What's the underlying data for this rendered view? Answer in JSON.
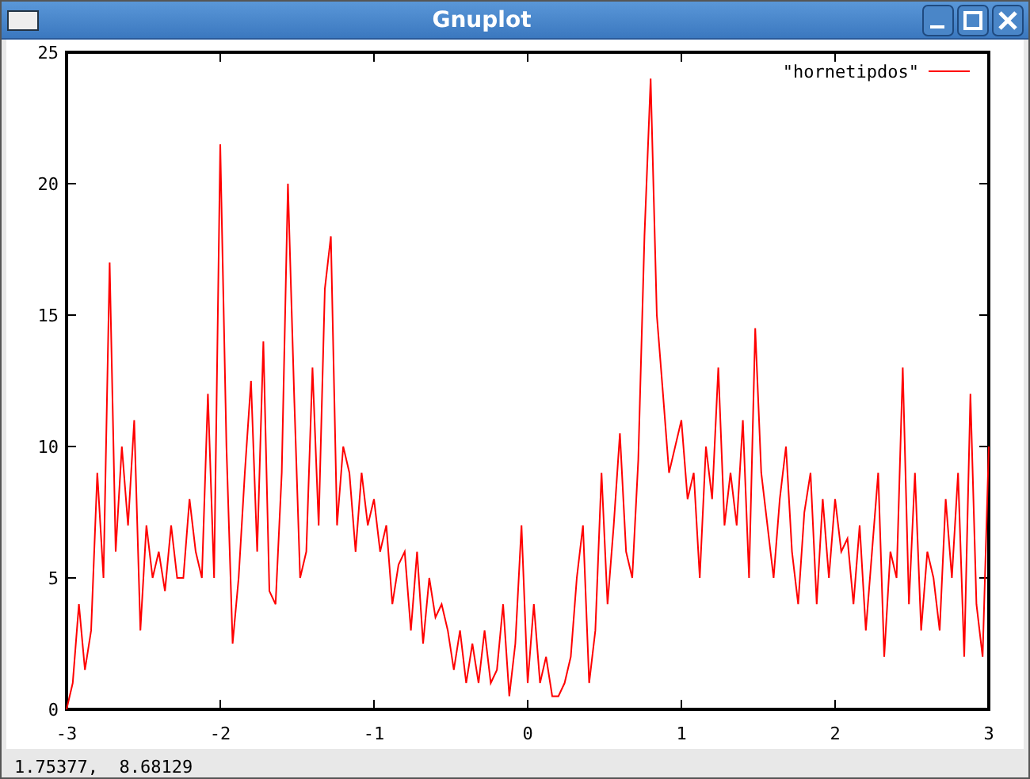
{
  "window": {
    "title": "Gnuplot"
  },
  "plot": {
    "chart_data": {
      "type": "line",
      "xlim": [
        -3,
        3
      ],
      "ylim": [
        0,
        25
      ],
      "xticks": [
        -3,
        -2,
        -1,
        0,
        1,
        2,
        3
      ],
      "yticks": [
        0,
        5,
        10,
        15,
        20,
        25
      ],
      "x": [
        -3,
        -2.96,
        -2.92,
        -2.88,
        -2.84,
        -2.8,
        -2.76,
        -2.72,
        -2.68,
        -2.64,
        -2.6,
        -2.56,
        -2.52,
        -2.48,
        -2.44,
        -2.4,
        -2.36,
        -2.32,
        -2.28,
        -2.24,
        -2.2,
        -2.16,
        -2.12,
        -2.08,
        -2.04,
        -2,
        -1.96,
        -1.92,
        -1.88,
        -1.84,
        -1.8,
        -1.76,
        -1.72,
        -1.68,
        -1.64,
        -1.6,
        -1.56,
        -1.52,
        -1.48,
        -1.44,
        -1.4,
        -1.36,
        -1.32,
        -1.28,
        -1.24,
        -1.2,
        -1.16,
        -1.12,
        -1.08,
        -1.04,
        -1,
        -0.96,
        -0.92,
        -0.88,
        -0.84,
        -0.8,
        -0.76,
        -0.72,
        -0.68,
        -0.64,
        -0.6,
        -0.56,
        -0.52,
        -0.48,
        -0.44,
        -0.4,
        -0.36,
        -0.32,
        -0.28,
        -0.24,
        -0.2,
        -0.16,
        -0.12,
        -0.08,
        -0.04,
        0,
        0.04,
        0.08,
        0.12,
        0.16,
        0.2,
        0.24,
        0.28,
        0.32,
        0.36,
        0.4,
        0.44,
        0.48,
        0.52,
        0.56,
        0.6,
        0.64,
        0.68,
        0.72,
        0.76,
        0.8,
        0.84,
        0.88,
        0.92,
        0.96,
        1,
        1.04,
        1.08,
        1.12,
        1.16,
        1.2,
        1.24,
        1.28,
        1.32,
        1.36,
        1.4,
        1.44,
        1.48,
        1.52,
        1.56,
        1.6,
        1.64,
        1.68,
        1.72,
        1.76,
        1.8,
        1.84,
        1.88,
        1.92,
        1.96,
        2,
        2.04,
        2.08,
        2.12,
        2.16,
        2.2,
        2.24,
        2.28,
        2.32,
        2.36,
        2.4,
        2.44,
        2.48,
        2.52,
        2.56,
        2.6,
        2.64,
        2.68,
        2.72,
        2.76,
        2.8,
        2.84,
        2.88,
        2.92,
        2.96,
        3
      ],
      "series": [
        {
          "name": "\"hornetipdos\"",
          "color": "#ff0000",
          "values": [
            0,
            1,
            4,
            1.5,
            3,
            9,
            5,
            17,
            6,
            10,
            7,
            11,
            3,
            7,
            5,
            6,
            4.5,
            7,
            5,
            5,
            8,
            6,
            5,
            12,
            5,
            21.5,
            10,
            2.5,
            5,
            9,
            12.5,
            6,
            14,
            4.5,
            4,
            9,
            20,
            12,
            5,
            6,
            13,
            7,
            16,
            18,
            7,
            10,
            9,
            6,
            9,
            7,
            8,
            6,
            7,
            4,
            5.5,
            6,
            3,
            6,
            2.5,
            5,
            3.5,
            4,
            3,
            1.5,
            3,
            1,
            2.5,
            1,
            3,
            1,
            1.5,
            4,
            0.5,
            2.5,
            7,
            1,
            4,
            1,
            2,
            0.5,
            0.5,
            1,
            2,
            5,
            7,
            1,
            3,
            9,
            4,
            7,
            10.5,
            6,
            5,
            9.5,
            18,
            24,
            15,
            12,
            9,
            10,
            11,
            8,
            9,
            5,
            10,
            8,
            13,
            7,
            9,
            7,
            11,
            5,
            14.5,
            9,
            7,
            5,
            8,
            10,
            6,
            4,
            7.5,
            9,
            4,
            8,
            5,
            8,
            6,
            6.5,
            4,
            7,
            3,
            6,
            9,
            2,
            6,
            5,
            13,
            4,
            9,
            3,
            6,
            5,
            3,
            8,
            5,
            9,
            2,
            12,
            4,
            2,
            10
          ]
        }
      ]
    }
  },
  "status_bar": {
    "text": "1.75377,  8.68129"
  }
}
